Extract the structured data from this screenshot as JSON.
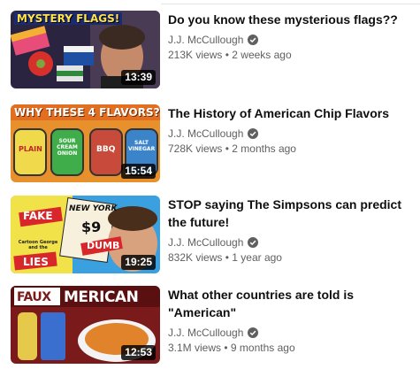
{
  "videos": [
    {
      "title": "Do you know these mysterious flags??",
      "channel": "J.J. McCullough",
      "views": "213K views",
      "age": "2 weeks ago",
      "duration": "13:39",
      "thumb_text": "MYSTERY FLAGS!",
      "thumb_accent": "#1a1a2e"
    },
    {
      "title": "The History of American Chip Flavors",
      "channel": "J.J. McCullough",
      "views": "728K views",
      "age": "2 months ago",
      "duration": "15:54",
      "thumb_text": "WHY THESE 4 FLAVORS?",
      "thumb_labels": [
        "PLAIN",
        "SOUR CREAM ONION",
        "BBQ",
        "SALT VINEGAR"
      ],
      "thumb_accent": "#e8902c"
    },
    {
      "title": "STOP saying The Simpsons can predict the future!",
      "channel": "J.J. McCullough",
      "views": "832K views",
      "age": "1 year ago",
      "duration": "19:25",
      "thumb_labels": [
        "FAKE",
        "NEW YORK",
        "$9",
        "DUMB",
        "LIES",
        "Cartoon George and the"
      ],
      "thumb_accent": "#3aa0e0"
    },
    {
      "title": "What other countries are told is \"American\"",
      "channel": "J.J. McCullough",
      "views": "3.1M views",
      "age": "9 months ago",
      "duration": "12:53",
      "thumb_text_a": "FAUX",
      "thumb_text_b": "MERICAN",
      "thumb_accent": "#7a1a1a"
    }
  ],
  "separator": "•"
}
